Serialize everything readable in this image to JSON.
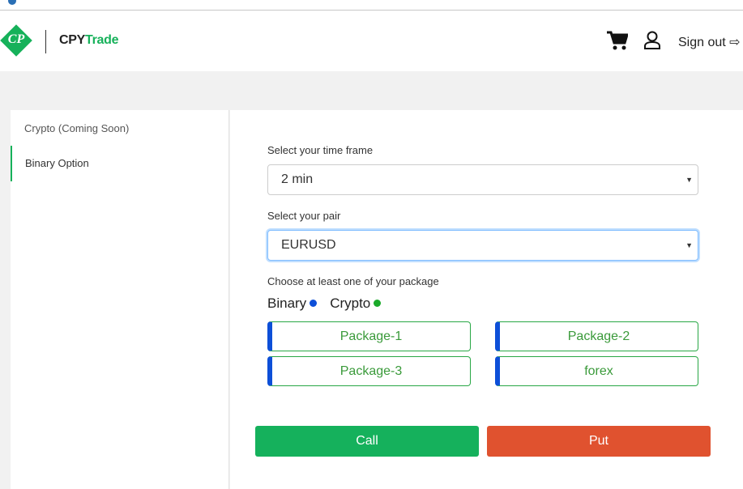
{
  "header": {
    "logo_text": "CP",
    "brand_part1": "CPY",
    "brand_part2": "Trade",
    "signout_label": "Sign out",
    "icons": [
      "cart-icon",
      "user-icon",
      "sign-out-icon"
    ]
  },
  "sidebar": {
    "items": [
      {
        "label": "Crypto (Coming Soon)",
        "active": false
      },
      {
        "label": "Binary Option",
        "active": true
      }
    ]
  },
  "form": {
    "timeframe_label": "Select your time frame",
    "timeframe_value": "2 min",
    "pair_label": "Select your pair",
    "pair_value": "EURUSD",
    "package_label": "Choose at least one of your package",
    "legend": [
      {
        "label": "Binary",
        "color": "#0d4fd8"
      },
      {
        "label": "Crypto",
        "color": "#1aaa2a"
      }
    ],
    "packages": [
      "Package-1",
      "Package-2",
      "Package-3",
      "forex"
    ]
  },
  "actions": {
    "call_label": "Call",
    "call_color": "#15b15c",
    "put_label": "Put",
    "put_color": "#e0522f"
  }
}
